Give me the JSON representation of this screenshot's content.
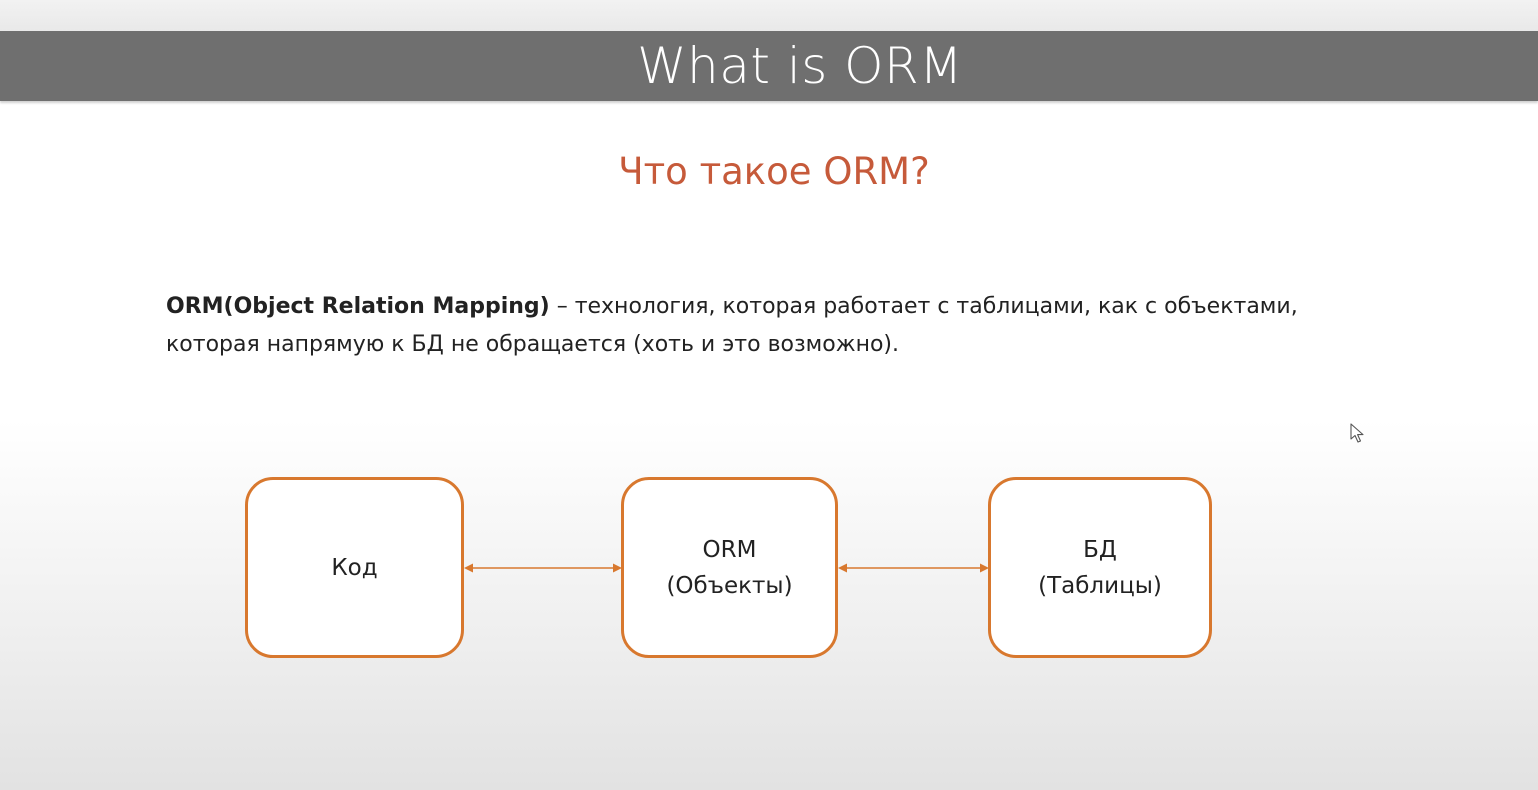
{
  "slide": {
    "title": "What is ORM",
    "subtitle": "Что такое ORM?",
    "definition": {
      "term": "ORM(Object Relation Mapping)",
      "line1_rest": " – технология, которая работает с таблицами, как с объектами,",
      "line2": "которая напрямую к БД не обращается (хоть и это возможно)."
    },
    "diagram": {
      "code_box": {
        "label": "Код"
      },
      "orm_box": {
        "line1": "ORM",
        "line2": "(Объекты)"
      },
      "db_box": {
        "line1": "БД",
        "line2": "(Таблицы)"
      }
    }
  },
  "colors": {
    "title_bar": "#6f6f6f",
    "title_text": "#ffffff",
    "subtitle": "#c65a3a",
    "box_border": "#d8782e",
    "arrow": "#d8782e"
  },
  "icons": {
    "arrows": "double-headed-arrow",
    "cursor": "mouse-pointer-icon"
  }
}
